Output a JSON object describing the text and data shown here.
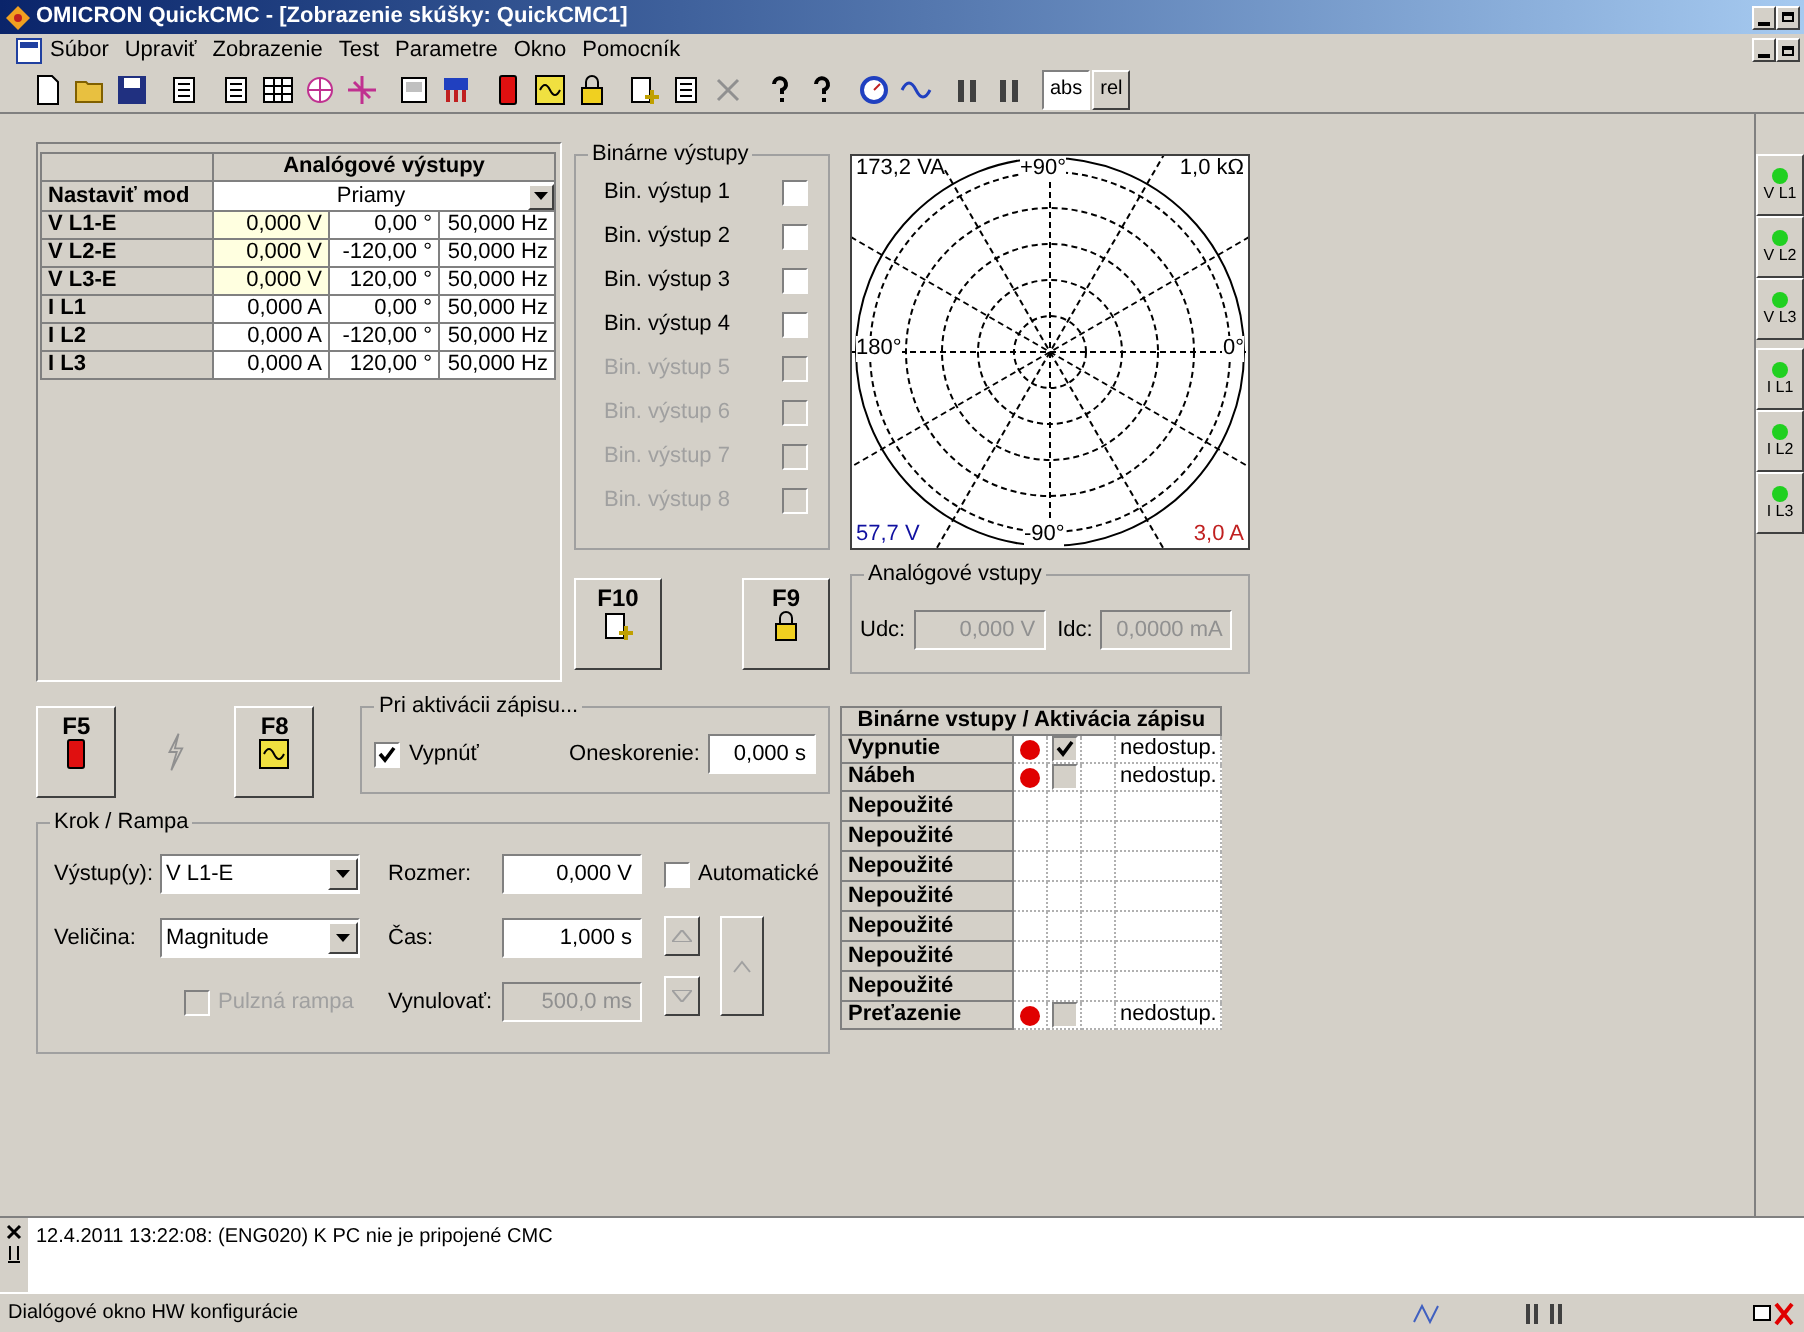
{
  "window": {
    "title": "OMICRON QuickCMC - [Zobrazenie skúšky: QuickCMC1]"
  },
  "menu": [
    "Súbor",
    "Upraviť",
    "Zobrazenie",
    "Test",
    "Parametre",
    "Okno",
    "Pomocník"
  ],
  "toolbar": {
    "toggles": [
      {
        "label": "abs",
        "selected": true
      },
      {
        "label": "rel",
        "selected": false
      }
    ]
  },
  "analog_outputs": {
    "title": "Analógové výstupy",
    "mode_label": "Nastaviť mod",
    "mode_value": "Priamy",
    "rows": [
      {
        "name": "V L1-E",
        "magnitude": "0,000 V",
        "phase": "0,00 °",
        "frequency": "50,000 Hz",
        "highlighted": true
      },
      {
        "name": "V L2-E",
        "magnitude": "0,000 V",
        "phase": "-120,00 °",
        "frequency": "50,000 Hz",
        "highlighted": true
      },
      {
        "name": "V L3-E",
        "magnitude": "0,000 V",
        "phase": "120,00 °",
        "frequency": "50,000 Hz",
        "highlighted": true
      },
      {
        "name": "I L1",
        "magnitude": "0,000 A",
        "phase": "0,00 °",
        "frequency": "50,000 Hz",
        "highlighted": false
      },
      {
        "name": "I L2",
        "magnitude": "0,000 A",
        "phase": "-120,00 °",
        "frequency": "50,000 Hz",
        "highlighted": false
      },
      {
        "name": "I L3",
        "magnitude": "0,000 A",
        "phase": "120,00 °",
        "frequency": "50,000 Hz",
        "highlighted": false
      }
    ]
  },
  "binary_outputs": {
    "title": "Binárne výstupy",
    "items": [
      {
        "label": "Bin. výstup 1",
        "checked": false,
        "disabled": false
      },
      {
        "label": "Bin. výstup 2",
        "checked": false,
        "disabled": false
      },
      {
        "label": "Bin. výstup 3",
        "checked": false,
        "disabled": false
      },
      {
        "label": "Bin. výstup 4",
        "checked": false,
        "disabled": false
      },
      {
        "label": "Bin. výstup 5",
        "checked": false,
        "disabled": true
      },
      {
        "label": "Bin. výstup 6",
        "checked": false,
        "disabled": true
      },
      {
        "label": "Bin. výstup 7",
        "checked": false,
        "disabled": true
      },
      {
        "label": "Bin. výstup 8",
        "checked": false,
        "disabled": true
      }
    ]
  },
  "keys": {
    "f10": "F10",
    "f9": "F9",
    "f5": "F5",
    "f8": "F8"
  },
  "vector_diagram": {
    "top_left": "173,2 VA",
    "top": "+90°",
    "top_right": "1,0 kΩ",
    "left": "180°",
    "right": "0°",
    "bottom_left": "57,7 V",
    "bottom": "-90°",
    "bottom_right": "3,0 A"
  },
  "analog_inputs": {
    "title": "Analógové vstupy",
    "udc_label": "Udc:",
    "udc_value": "0,000 V",
    "idc_label": "Idc:",
    "idc_value": "0,0000 mA"
  },
  "trigger": {
    "title": "Pri aktivácii zápisu...",
    "trip_label": "Vypnúť",
    "trip_checked": true,
    "delay_label": "Oneskorenie:",
    "delay_value": "0,000 s"
  },
  "step_ramp": {
    "title": "Krok / Rampa",
    "output_label": "Výstup(y):",
    "output_value": "V L1-E",
    "size_label": "Rozmer:",
    "size_value": "0,000 V",
    "auto_label": "Automatické",
    "auto_checked": false,
    "quantity_label": "Veličina:",
    "quantity_value": "Magnitude",
    "time_label": "Čas:",
    "time_value": "1,000 s",
    "pulse_label": "Pulzná rampa",
    "pulse_checked": false,
    "pulse_disabled": true,
    "reset_label": "Vynulovať:",
    "reset_value": "500,0 ms"
  },
  "binary_inputs": {
    "title": "Binárne vstupy / Aktivácia zápisu",
    "rows": [
      {
        "kind": "used",
        "name": "Vypnutie",
        "checked": true,
        "status": "nedostup."
      },
      {
        "kind": "used",
        "name": "Nábeh",
        "checked": false,
        "status": "nedostup."
      },
      {
        "kind": "unused",
        "name": "Nepoužité"
      },
      {
        "kind": "unused",
        "name": "Nepoužité"
      },
      {
        "kind": "unused",
        "name": "Nepoužité"
      },
      {
        "kind": "unused",
        "name": "Nepoužité"
      },
      {
        "kind": "unused",
        "name": "Nepoužité"
      },
      {
        "kind": "unused",
        "name": "Nepoužité"
      },
      {
        "kind": "unused",
        "name": "Nepoužité"
      },
      {
        "kind": "used",
        "name": "Preťazenie",
        "checked": false,
        "status": "nedostup."
      }
    ]
  },
  "channels": [
    "V L1",
    "V L2",
    "V L3",
    "I L1",
    "I L2",
    "I L3"
  ],
  "log": [
    "12.4.2011 13:22:08: (ENG020) K PC nie je pripojené CMC"
  ],
  "status_bar": {
    "text": "Dialógové okno HW konfigurácie"
  }
}
